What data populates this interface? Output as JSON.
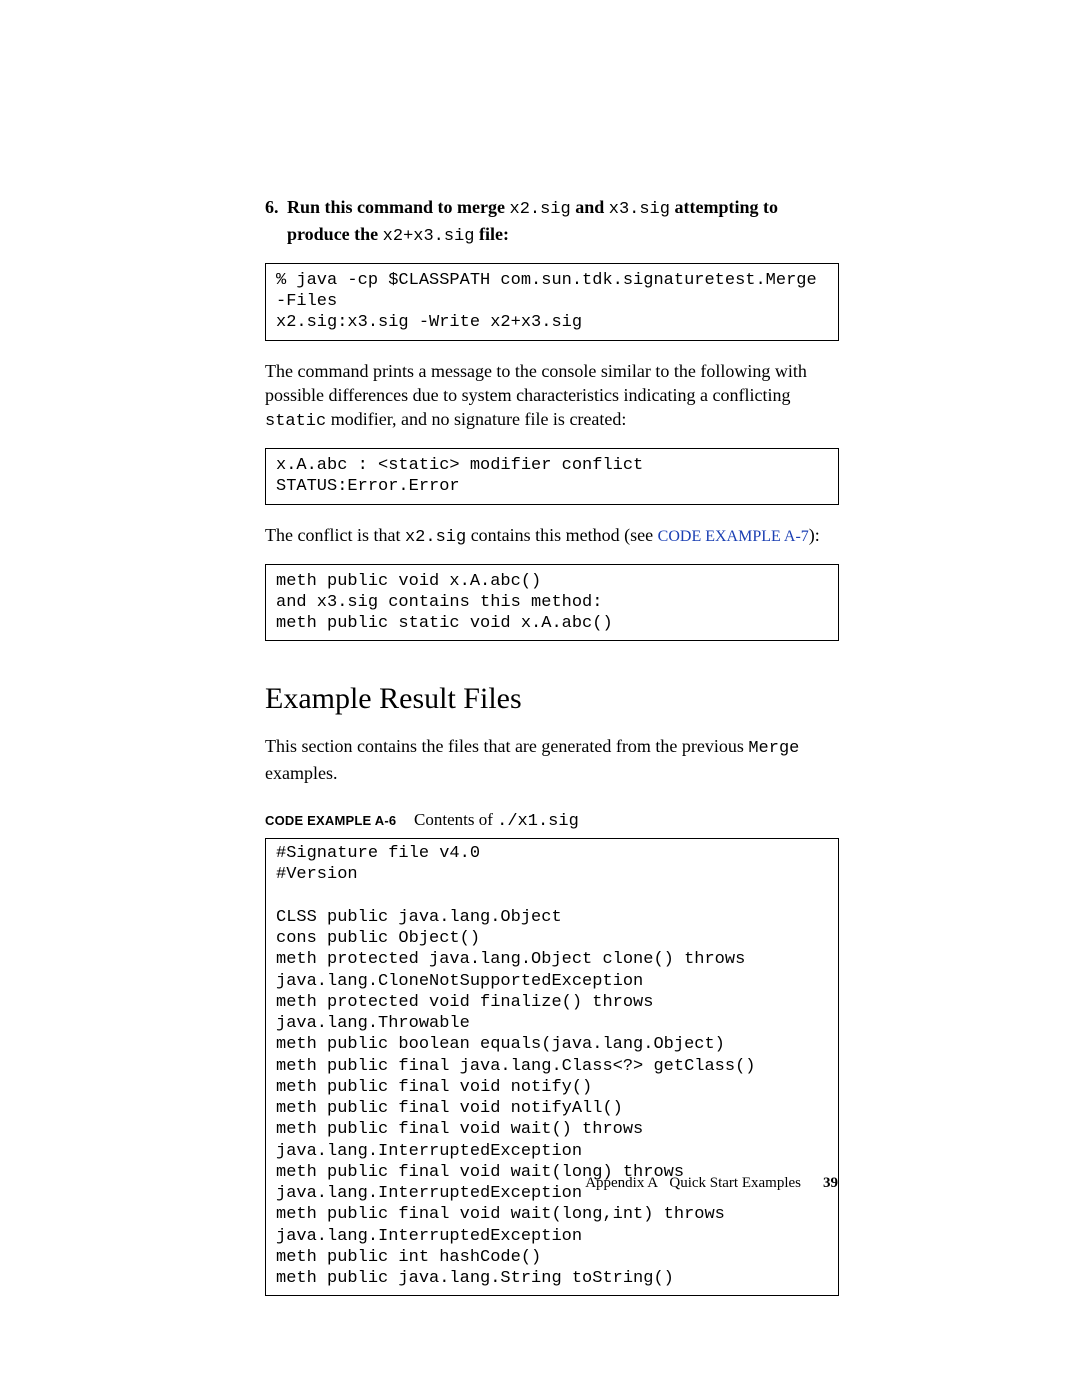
{
  "step": {
    "number": "6.",
    "parts": {
      "t1": "Run this command to merge ",
      "c1": "x2.sig",
      "t2": " and ",
      "c2": "x3.sig",
      "t3": " attempting to produce the ",
      "c3": "x2+x3.sig",
      "t4": " file:"
    }
  },
  "code1": "% java -cp $CLASSPATH com.sun.tdk.signaturetest.Merge -Files\nx2.sig:x3.sig -Write x2+x3.sig",
  "para1": {
    "t1": "The command prints a message to the console similar to the following with possible differences due to system characteristics indicating a conflicting ",
    "c1": "static",
    "t2": " modifier, and no signature file is created:"
  },
  "code2": "x.A.abc : <static> modifier conflict\nSTATUS:Error.Error",
  "para2": {
    "t1": "The conflict is that ",
    "c1": "x2.sig",
    "t2": " contains this method (see ",
    "link": "CODE EXAMPLE A-7",
    "t3": "):"
  },
  "code3": "meth public void x.A.abc()\nand x3.sig contains this method:\nmeth public static void x.A.abc()",
  "section_heading": "Example Result Files",
  "para3": {
    "t1": "This section contains the files that are generated from the previous ",
    "c1": "Merge",
    "t2": " examples."
  },
  "caption": {
    "label": "CODE EXAMPLE A-6",
    "desc_t1": "Contents of ",
    "desc_c1": "./x1.sig"
  },
  "code4": "#Signature file v4.0\n#Version\n\nCLSS public java.lang.Object\ncons public Object()\nmeth protected java.lang.Object clone() throws\njava.lang.CloneNotSupportedException\nmeth protected void finalize() throws java.lang.Throwable\nmeth public boolean equals(java.lang.Object)\nmeth public final java.lang.Class<?> getClass()\nmeth public final void notify()\nmeth public final void notifyAll()\nmeth public final void wait() throws\njava.lang.InterruptedException\nmeth public final void wait(long) throws\njava.lang.InterruptedException\nmeth public final void wait(long,int) throws\njava.lang.InterruptedException\nmeth public int hashCode()\nmeth public java.lang.String toString()",
  "footer": {
    "appendix": "Appendix A",
    "title": "Quick Start Examples",
    "page": "39"
  }
}
